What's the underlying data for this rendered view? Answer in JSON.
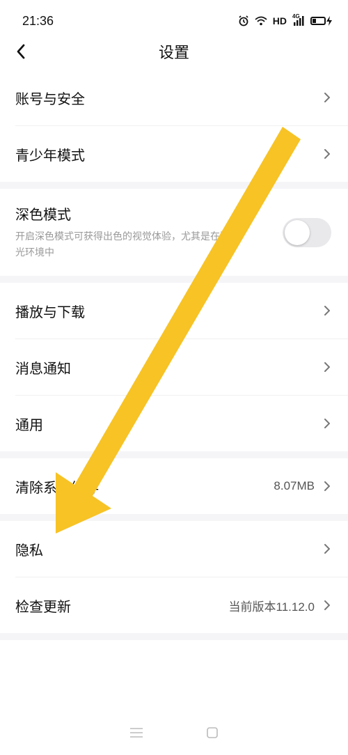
{
  "status_bar": {
    "time": "21:36",
    "hd": "HD",
    "network": "4G"
  },
  "header": {
    "title": "设置"
  },
  "sections": {
    "account": {
      "item1": "账号与安全",
      "item2": "青少年模式"
    },
    "dark_mode": {
      "title": "深色模式",
      "desc_line1": "开启深色模式可获得出色的视觉体验，尤其是在弱",
      "desc_line2": "光环境中",
      "enabled": false
    },
    "general": {
      "item1": "播放与下载",
      "item2": "消息通知",
      "item3": "通用"
    },
    "cache": {
      "label": "清除系统缓存",
      "value": "8.07MB"
    },
    "privacy": {
      "item1": "隐私",
      "item2_label": "检查更新",
      "item2_value": "当前版本11.12.0"
    }
  },
  "colors": {
    "arrow": "#F7C325",
    "section_bg": "#f5f5f7",
    "toggle_off": "#e9e9ec"
  }
}
